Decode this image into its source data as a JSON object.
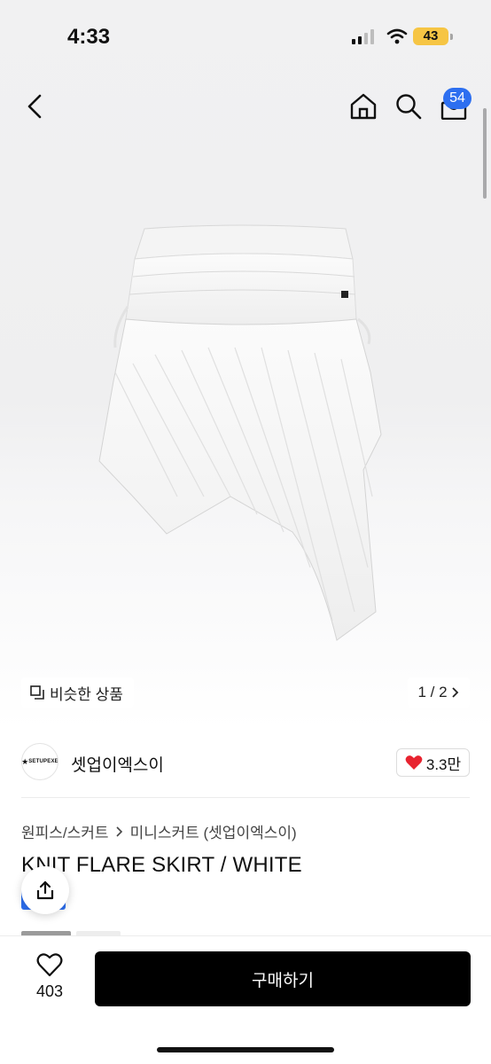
{
  "status_bar": {
    "time": "4:33",
    "battery": "43"
  },
  "header": {
    "cart_badge": "54"
  },
  "product_image": {
    "alt": "skirt-photo"
  },
  "image_overlay": {
    "similar_label": "비슷한 상품",
    "pager": "1 / 2"
  },
  "store": {
    "logo_text": "SETUPEXE",
    "name": "셋업이엑스이",
    "likes": "3.3만"
  },
  "breadcrumb": {
    "level1": "원피스/스커트",
    "level2": "미니스커트 (셋업이엑스이)"
  },
  "product": {
    "title": "KNIT FLARE SKIRT / WHITE"
  },
  "bottom_bar": {
    "like_count": "403",
    "buy_label": "구매하기"
  },
  "colors": {
    "accent": "#2d6ff0",
    "heart": "#e8232f",
    "buy_bg": "#000000"
  }
}
